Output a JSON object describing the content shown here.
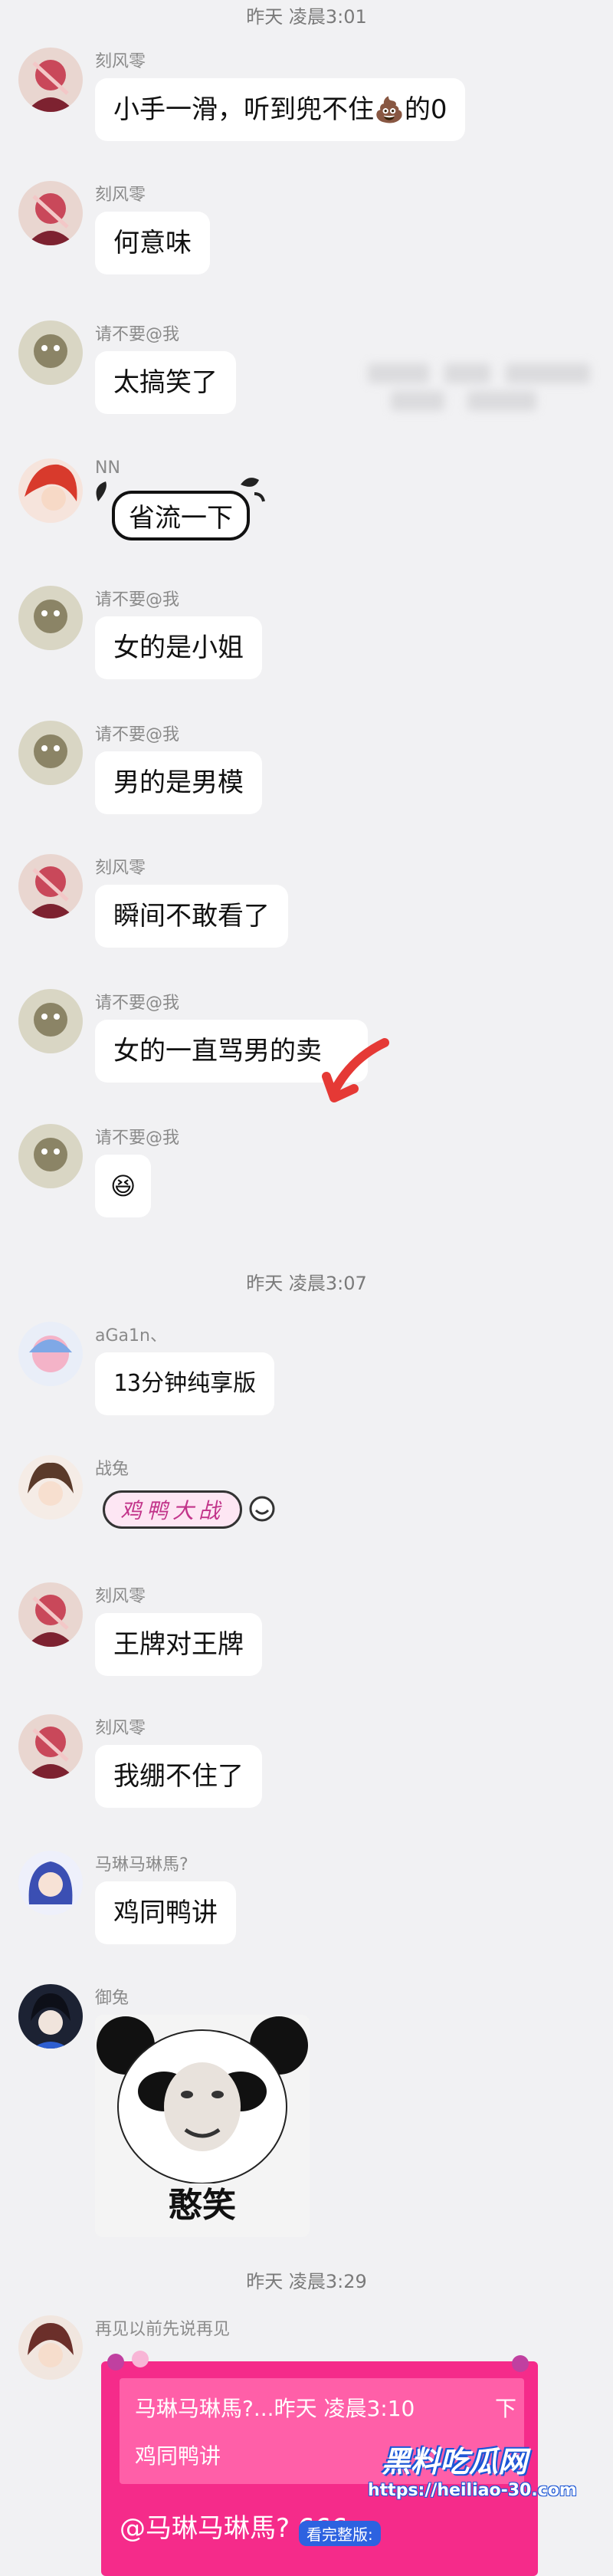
{
  "timestamps": [
    "昨天 凌晨3:01",
    "昨天 凌晨3:07",
    "昨天 凌晨3:29"
  ],
  "messages": [
    {
      "sender": "刻风零",
      "text": "小手一滑，听到兜不住",
      "emoji": "💩",
      "suffix": "的0"
    },
    {
      "sender": "刻风零",
      "text": "何意味"
    },
    {
      "sender": "请不要@我",
      "text": "太搞笑了"
    },
    {
      "sender": "NN",
      "sticker_text": "省流一下"
    },
    {
      "sender": "请不要@我",
      "text": "女的是小姐"
    },
    {
      "sender": "请不要@我",
      "text": "男的是男模"
    },
    {
      "sender": "刻风零",
      "text": "瞬间不敢看了"
    },
    {
      "sender": "请不要@我",
      "text": "女的一直骂男的卖"
    },
    {
      "sender": "请不要@我",
      "emoji": "😆"
    },
    {
      "sender": "aGa1n、",
      "text": "13分钟纯享版"
    },
    {
      "sender": "战兔",
      "sticker_text": "鸡鸭大战"
    },
    {
      "sender": "刻风零",
      "text": "王牌对王牌"
    },
    {
      "sender": "刻风零",
      "text": "我绷不住了"
    },
    {
      "sender": "马琳马琳馬?",
      "text": "鸡同鸭讲"
    },
    {
      "sender": "御兔",
      "sticker_caption": "憨笑"
    },
    {
      "sender": "再见以前先说再见",
      "quote": {
        "line1": "马琳马琳馬?...昨天 凌晨3:10",
        "line1_icon": "下",
        "line2": "鸡同鸭讲"
      },
      "text": "@马琳马琳馬? 666"
    }
  ],
  "watermark": {
    "brand": "黑料吃瓜网",
    "url": "https://heiliao-30.com",
    "tag": "看完整版:"
  },
  "colors": {
    "background": "#f1f1f3",
    "bubble": "#ffffff",
    "quote_card": "#f52b8a",
    "arrow": "#e53935"
  }
}
